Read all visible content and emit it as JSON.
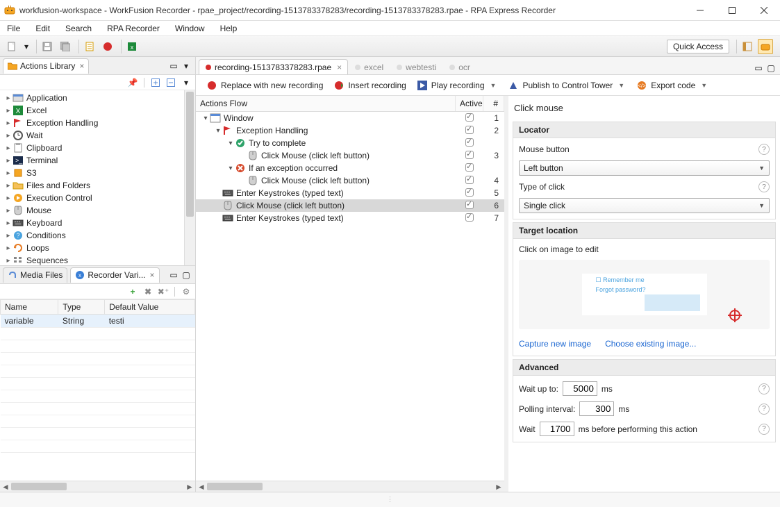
{
  "window": {
    "title": "workfusion-workspace - WorkFusion Recorder - rpae_project/recording-1513783378283/recording-1513783378283.rpae - RPA Express Recorder"
  },
  "menu": [
    "File",
    "Edit",
    "Search",
    "RPA Recorder",
    "Window",
    "Help"
  ],
  "quick_access": "Quick Access",
  "left": {
    "actions_library_tab": "Actions Library",
    "tree": [
      {
        "label": "Application",
        "icon": "app"
      },
      {
        "label": "Excel",
        "icon": "excel"
      },
      {
        "label": "Exception Handling",
        "icon": "flag"
      },
      {
        "label": "Wait",
        "icon": "wait"
      },
      {
        "label": "Clipboard",
        "icon": "clipboard"
      },
      {
        "label": "Terminal",
        "icon": "terminal"
      },
      {
        "label": "S3",
        "icon": "s3"
      },
      {
        "label": "Files and Folders",
        "icon": "folder"
      },
      {
        "label": "Execution Control",
        "icon": "exec"
      },
      {
        "label": "Mouse",
        "icon": "mouse"
      },
      {
        "label": "Keyboard",
        "icon": "keyboard"
      },
      {
        "label": "Conditions",
        "icon": "conditions"
      },
      {
        "label": "Loops",
        "icon": "loops"
      },
      {
        "label": "Sequences",
        "icon": "sequences"
      }
    ],
    "media_tab": "Media Files",
    "vars_tab": "Recorder Vari...",
    "vars_cols": {
      "name": "Name",
      "type": "Type",
      "default": "Default Value"
    },
    "vars_rows": [
      {
        "name": "variable",
        "type": "String",
        "default": "testi"
      }
    ]
  },
  "editor": {
    "tabs": [
      {
        "label": "recording-1513783378283.rpae",
        "active": true
      },
      {
        "label": "excel",
        "active": false
      },
      {
        "label": "webtesti",
        "active": false
      },
      {
        "label": "ocr",
        "active": false
      }
    ],
    "toolbar": {
      "replace": "Replace with new recording",
      "insert": "Insert recording",
      "play": "Play recording",
      "publish": "Publish to Control Tower",
      "export": "Export code"
    },
    "flow_header": {
      "name": "Actions Flow",
      "active": "Active",
      "num": "#"
    },
    "flow": [
      {
        "depth": 0,
        "tw": "v",
        "icon": "window",
        "label": "Window",
        "checked": true,
        "num": "1"
      },
      {
        "depth": 1,
        "tw": "v",
        "icon": "flag",
        "label": "Exception Handling",
        "checked": true,
        "num": "2"
      },
      {
        "depth": 2,
        "tw": "v",
        "icon": "try",
        "label": "Try to complete",
        "checked": true,
        "num": ""
      },
      {
        "depth": 3,
        "tw": "",
        "icon": "mouse",
        "label": "Click Mouse (click left button)",
        "checked": true,
        "num": "3"
      },
      {
        "depth": 2,
        "tw": "v",
        "icon": "except",
        "label": "If an exception occurred",
        "checked": true,
        "num": ""
      },
      {
        "depth": 3,
        "tw": "",
        "icon": "mouse",
        "label": "Click Mouse (click left button)",
        "checked": true,
        "num": "4"
      },
      {
        "depth": 1,
        "tw": "",
        "icon": "keyboard",
        "label": "Enter Keystrokes (typed text)",
        "checked": true,
        "num": "5"
      },
      {
        "depth": 1,
        "tw": "",
        "icon": "mouse",
        "label": "Click Mouse (click left button)",
        "checked": true,
        "num": "6",
        "sel": true
      },
      {
        "depth": 1,
        "tw": "",
        "icon": "keyboard",
        "label": "Enter Keystrokes (typed text)",
        "checked": true,
        "num": "7"
      }
    ]
  },
  "props": {
    "title": "Click mouse",
    "locator_hdr": "Locator",
    "mouse_button_lbl": "Mouse button",
    "mouse_button_val": "Left button",
    "type_click_lbl": "Type of click",
    "type_click_val": "Single click",
    "target_hdr": "Target location",
    "target_hint": "Click on image to edit",
    "preview": {
      "remember": "Remember me",
      "forgot": "Forgot password?"
    },
    "capture": "Capture new image",
    "choose": "Choose existing image...",
    "advanced_hdr": "Advanced",
    "wait_up_lbl": "Wait up to:",
    "wait_up_val": "5000",
    "ms": "ms",
    "polling_lbl": "Polling interval:",
    "polling_val": "300",
    "wait_before_lbl": "Wait",
    "wait_before_val": "1700",
    "wait_before_suffix": "ms before performing this action"
  }
}
